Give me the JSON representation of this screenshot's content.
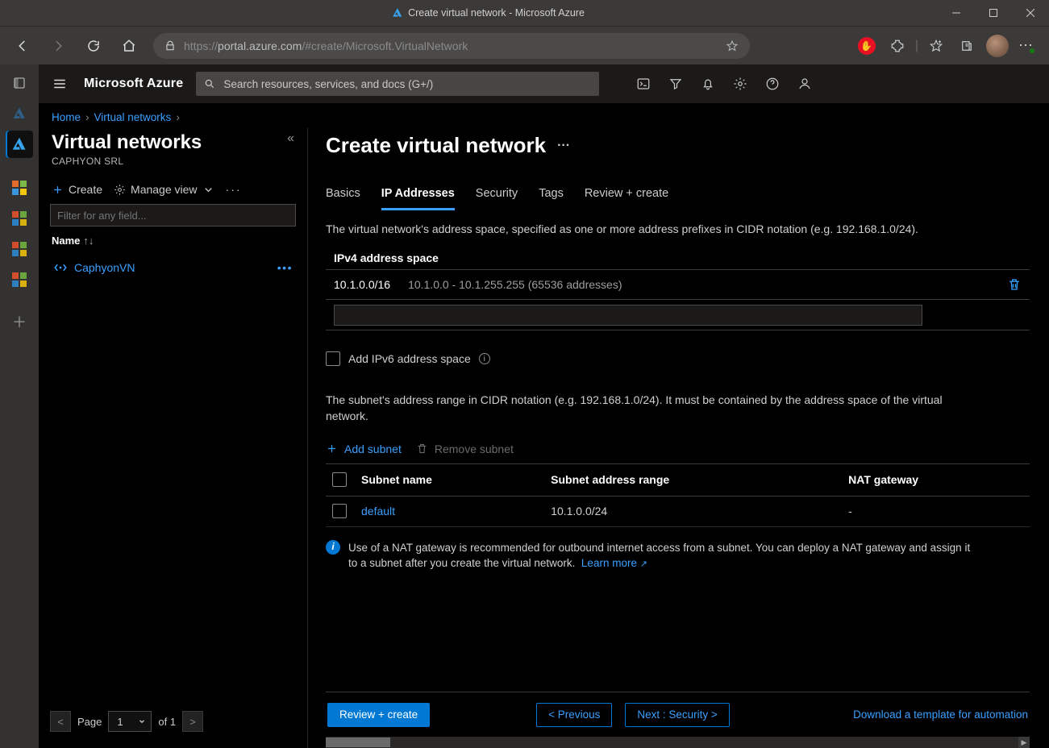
{
  "window": {
    "title": "Create virtual network - Microsoft Azure"
  },
  "browser": {
    "url_prefix": "https://",
    "url_host": "portal.azure.com",
    "url_path": "/#create/Microsoft.VirtualNetwork"
  },
  "portal_header": {
    "brand": "Microsoft Azure",
    "search_placeholder": "Search resources, services, and docs (G+/)"
  },
  "breadcrumbs": {
    "items": [
      "Home",
      "Virtual networks"
    ]
  },
  "left_pane": {
    "title": "Virtual networks",
    "subtitle": "CAPHYON SRL",
    "create_label": "Create",
    "manage_view_label": "Manage view",
    "filter_placeholder": "Filter for any field...",
    "name_column": "Name",
    "items": [
      {
        "name": "CaphyonVN"
      }
    ],
    "pager": {
      "page_label": "Page",
      "current": "1",
      "of_label": "of 1"
    }
  },
  "main": {
    "title": "Create virtual network",
    "tabs": [
      "Basics",
      "IP Addresses",
      "Security",
      "Tags",
      "Review + create"
    ],
    "active_tab": "IP Addresses",
    "description": "The virtual network's address space, specified as one or more address prefixes in CIDR notation (e.g. 192.168.1.0/24).",
    "ipv4_label": "IPv4 address space",
    "address_row": {
      "cidr": "10.1.0.0/16",
      "range": "10.1.0.0 - 10.1.255.255 (65536 addresses)"
    },
    "ipv6_label": "Add IPv6 address space",
    "subnet_desc": "The subnet's address range in CIDR notation (e.g. 192.168.1.0/24). It must be contained by the address space of the virtual network.",
    "add_subnet_label": "Add subnet",
    "remove_subnet_label": "Remove subnet",
    "subnet_table": {
      "cols": [
        "Subnet name",
        "Subnet address range",
        "NAT gateway"
      ],
      "rows": [
        {
          "name": "default",
          "range": "10.1.0.0/24",
          "nat": "-"
        }
      ]
    },
    "nat_info": "Use of a NAT gateway is recommended for outbound internet access from a subnet. You can deploy a NAT gateway and assign it to a subnet after you create the virtual network.",
    "learn_more": "Learn more"
  },
  "footer": {
    "review_create": "Review + create",
    "previous": "< Previous",
    "next": "Next : Security >",
    "download_template": "Download a template for automation"
  }
}
